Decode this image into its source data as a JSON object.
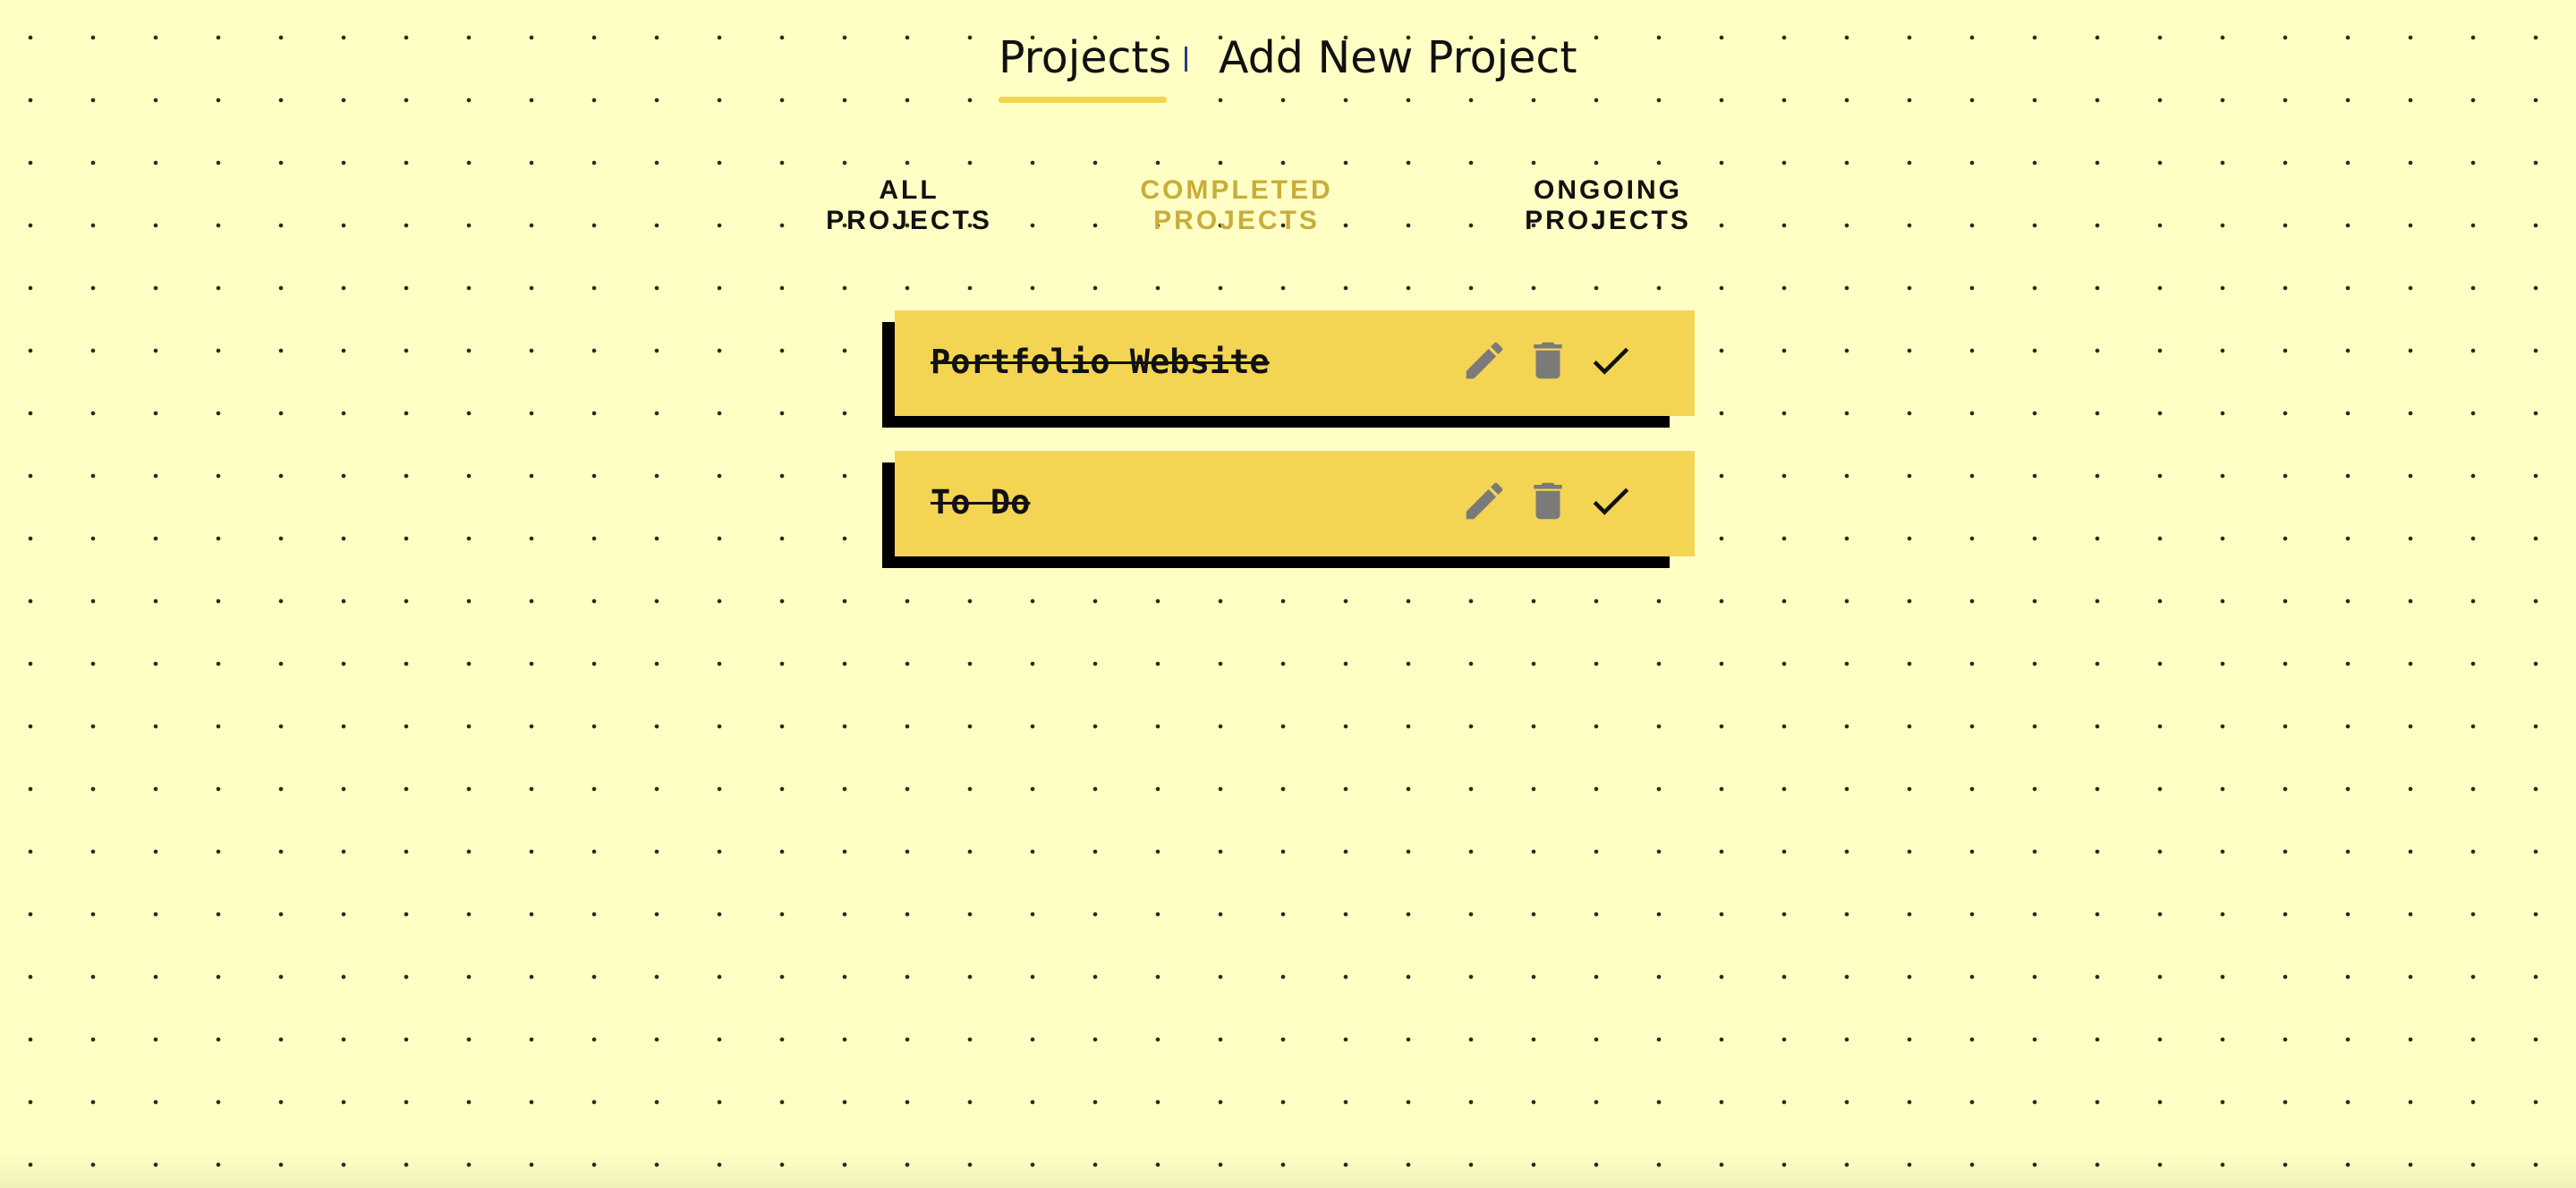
{
  "nav": {
    "projects_label": "Projects",
    "add_project_label": "Add New Project",
    "active_underline_color": "#f3d553"
  },
  "filters": {
    "all": {
      "line1": "ALL",
      "line2": "PROJECTS"
    },
    "completed": {
      "line1": "COMPLETED",
      "line2": "PROJECTS",
      "active": true,
      "color": "#c9ad3a"
    },
    "ongoing": {
      "line1": "ONGOING",
      "line2": "PROJECTS"
    }
  },
  "projects": [
    {
      "title": "Portfolio Website",
      "completed": true,
      "actions": [
        "pencil-icon",
        "trash-icon",
        "check-icon"
      ]
    },
    {
      "title": "To Do",
      "completed": true,
      "actions": [
        "pencil-icon",
        "trash-icon",
        "check-icon"
      ]
    }
  ],
  "colors": {
    "background": "#ffffc5",
    "card": "#f3d553",
    "card_shadow": "#000000",
    "action_icon": "#7a7a7a"
  }
}
